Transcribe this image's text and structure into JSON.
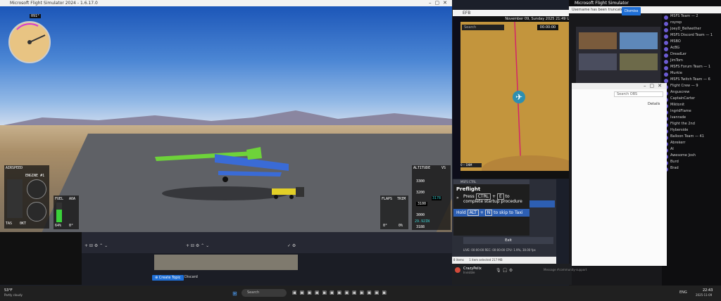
{
  "sim": {
    "title": "Microsoft Flight Simulator 2024 - 1.6.17.0",
    "heading": "091°",
    "airspeed_label": "AIRSPEED",
    "engine_label": "ENGINE #1",
    "fuel_label": "FUEL",
    "aoa_label": "AOA",
    "tas_label": "TAS",
    "tas_value": "0KT",
    "fuel_pct": "64%",
    "aoa_value": "0°",
    "flaps_label": "FLAPS",
    "trim_label": "TRIM",
    "flaps_value": "0°",
    "trim_value": "0%",
    "altitude_label": "ALTITUDE",
    "vs_label": "VS",
    "alt_ticks": [
      "3300",
      "3200",
      "3100",
      "3000"
    ],
    "alt_value": "3178",
    "baro": "29.92IN",
    "alt_bottom": "3188"
  },
  "map": {
    "title": "EFB",
    "datetime": "November 09, Sunday 2025 21:49 UTC",
    "search_placeholder": "Search",
    "logged_in": "Not logged in",
    "timer": "00:00:00"
  },
  "checklist": {
    "window_title": "MSFS CTRL",
    "heading": "Preflight",
    "step1": "Press",
    "key1a": "CTRL",
    "key1b": "E",
    "step1_rest": "to complete startup procedure",
    "step2": "Hold",
    "key2a": "ALT",
    "key2b": "N",
    "step2_rest": "to skip to Taxi"
  },
  "twitch": {
    "app_title": "Microsoft Flight Simulator",
    "notice": "Username has been truncated.",
    "notice_action": "Dismiss",
    "search_placeholder": "Search OBS",
    "details": "Details",
    "chat_lines": [
      "MSFS Team — 2",
      "royrep",
      "JoeyD_Bellwether",
      "MSFS Discord Team — 1",
      "MSBO",
      "AcBG",
      "DreadLer",
      "JimTom",
      "MSFS Forum Team — 1",
      "Murkie",
      "MSFS Twitch Team — 6",
      "Flight Crew — 9",
      "Anguscrew",
      "CaptainCarter",
      "Miktonit",
      "IngridFlame",
      "Ivanrade",
      "Flight the 2nd",
      "Hyberside",
      "Balloon Team — 41",
      "Abrekerr",
      "Al",
      "Awesome Josh",
      "Burd",
      "Brad"
    ]
  },
  "obs": {
    "live_status": "LIVE: 00:00:00   REC: 00:00:00   CPU: 1.9%, 30.00 fps",
    "exit_label": "Exit",
    "items_status": "1 item selected   217 MB",
    "bar_items": "8 items"
  },
  "clips": {
    "create_label": "Create Topic",
    "discard_label": "Discard"
  },
  "discord": {
    "user_name": "CrazyPelix",
    "user_status": "Invisible",
    "message_placeholder": "Message #community-support"
  },
  "taskbar": {
    "weather_temp": "53°F",
    "weather_desc": "Partly cloudy",
    "search_placeholder": "Search",
    "lang": "ENG",
    "time": "22:43",
    "date": "2025-11-09"
  }
}
